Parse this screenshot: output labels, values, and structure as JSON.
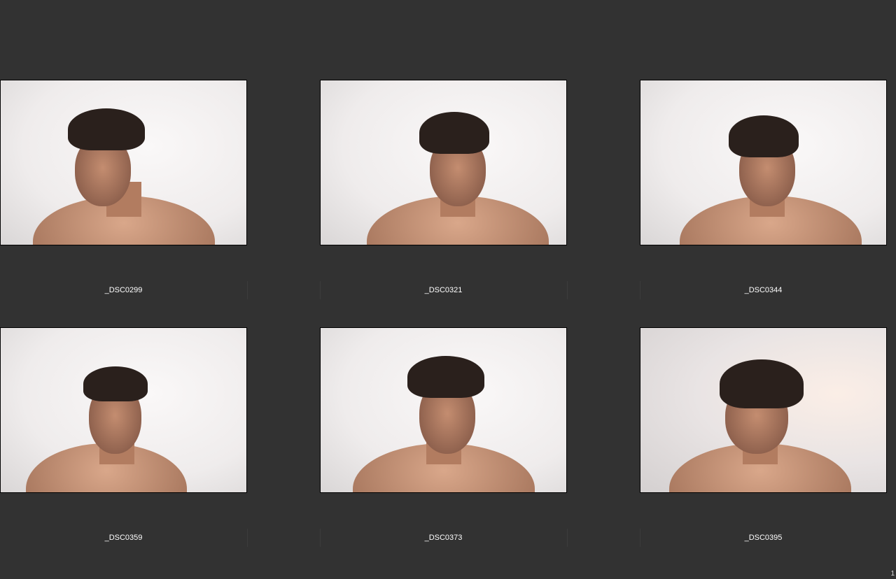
{
  "photos": [
    {
      "name": "_DSC0299"
    },
    {
      "name": "_DSC0321"
    },
    {
      "name": "_DSC0344"
    },
    {
      "name": "_DSC0359"
    },
    {
      "name": "_DSC0373"
    },
    {
      "name": "_DSC0395"
    }
  ],
  "page_number": "1"
}
